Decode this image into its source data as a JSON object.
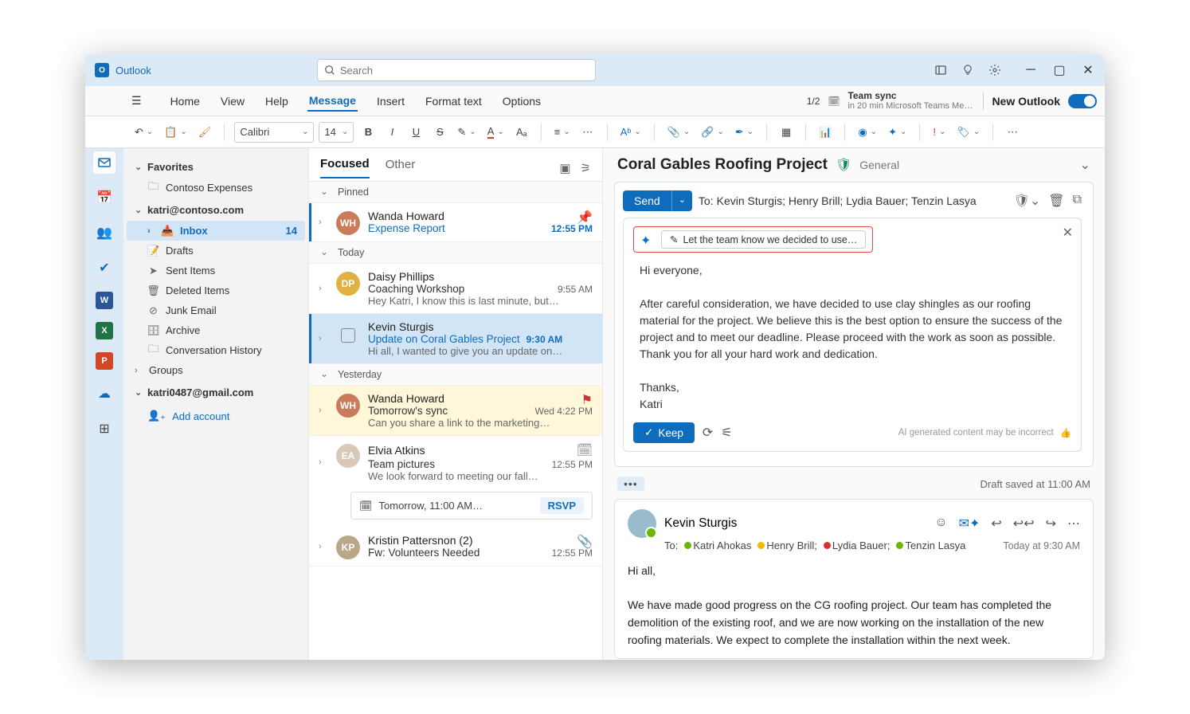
{
  "app": {
    "name": "Outlook"
  },
  "search": {
    "placeholder": "Search"
  },
  "titlebar_icons": [
    "panel",
    "lightbulb",
    "settings"
  ],
  "menu": {
    "tabs": [
      "Home",
      "View",
      "Help",
      "Message",
      "Insert",
      "Format text",
      "Options"
    ],
    "active": "Message",
    "counter": "1/2",
    "meeting": {
      "title": "Team sync",
      "sub": "in 20 min Microsoft Teams Mee…"
    },
    "new_outlook": "New Outlook"
  },
  "ribbon": {
    "font": "Calibri",
    "size": "14"
  },
  "nav": {
    "favorites": "Favorites",
    "fav_items": [
      "Contoso Expenses"
    ],
    "accounts": [
      {
        "name": "katri@contoso.com",
        "folders": [
          {
            "name": "Inbox",
            "badge": "14",
            "sel": true
          },
          {
            "name": "Drafts"
          },
          {
            "name": "Sent Items"
          },
          {
            "name": "Deleted Items"
          },
          {
            "name": "Junk Email"
          },
          {
            "name": "Archive"
          },
          {
            "name": "Conversation History"
          }
        ],
        "groups": "Groups"
      },
      {
        "name": "katri0487@gmail.com"
      }
    ],
    "add_account": "Add account"
  },
  "list": {
    "tabs": [
      "Focused",
      "Other"
    ],
    "sections": {
      "pinned": "Pinned",
      "today": "Today",
      "yesterday": "Yesterday"
    },
    "msgs": [
      {
        "from": "Wanda Howard",
        "subj": "Expense Report",
        "time": "12:55 PM",
        "avatar": "#c97b5a"
      },
      {
        "from": "Daisy Phillips",
        "subj": "Coaching Workshop",
        "time": "9:55 AM",
        "prev": "Hey Katri, I know this is last minute, but…",
        "avatar": "#e0b040"
      },
      {
        "from": "Kevin Sturgis",
        "subj": "Update on Coral Gables Project",
        "time": "9:30 AM",
        "prev": "Hi all, I wanted to give you an update on…"
      },
      {
        "from": "Wanda Howard",
        "subj": "Tomorrow's sync",
        "time": "Wed 4:22 PM",
        "prev": "Can you share a link to the marketing…",
        "avatar": "#c97b5a"
      },
      {
        "from": "Elvia Atkins",
        "subj": "Team pictures",
        "time": "12:55 PM",
        "prev": "We look forward to meeting our fall…",
        "avatar": "#d8c8b8"
      },
      {
        "from": "Kristin Pattersnon (2)",
        "subj": "Fw: Volunteers Needed",
        "time": "12:55 PM",
        "avatar": "#b8a888"
      }
    ],
    "rsvp": {
      "text": "Tomorrow, 11:00 AM…",
      "btn": "RSVP"
    }
  },
  "reading": {
    "title": "Coral Gables Roofing Project",
    "category": "General",
    "compose": {
      "send": "Send",
      "to_label": "To:",
      "to": "Kevin Sturgis; Henry Brill; Lydia Bauer; Tenzin Lasya",
      "copilot_prompt": "Let the team know we decided to use…",
      "body_greet": "Hi everyone,",
      "body_para": "After careful consideration, we have decided to use clay shingles as our roofing material for the project. We believe this is the best option to ensure the success of the project and to meet our deadline. Please proceed with the work as soon as possible.  Thank you for all your hard work and dedication.",
      "body_close": "Thanks,",
      "body_sig": "Katri",
      "keep": "Keep",
      "disclaimer": "AI generated content may be incorrect",
      "draft": "Draft saved at 11:00 AM"
    },
    "thread": {
      "from": "Kevin Sturgis",
      "to_label": "To:",
      "recipients": [
        {
          "name": "Katri Ahokas",
          "color": "#6bb700"
        },
        {
          "name": "Henry Brill;",
          "color": "#f2b900"
        },
        {
          "name": "Lydia Bauer;",
          "color": "#d13438"
        },
        {
          "name": "Tenzin Lasya",
          "color": "#6bb700"
        }
      ],
      "date": "Today at 9:30 AM",
      "greet": "Hi all,",
      "para": "We have made good progress on the CG roofing project. Our team has completed the demolition of the existing roof, and we are now working on the installation of the new roofing materials. We expect to complete the installation within the next week."
    }
  }
}
